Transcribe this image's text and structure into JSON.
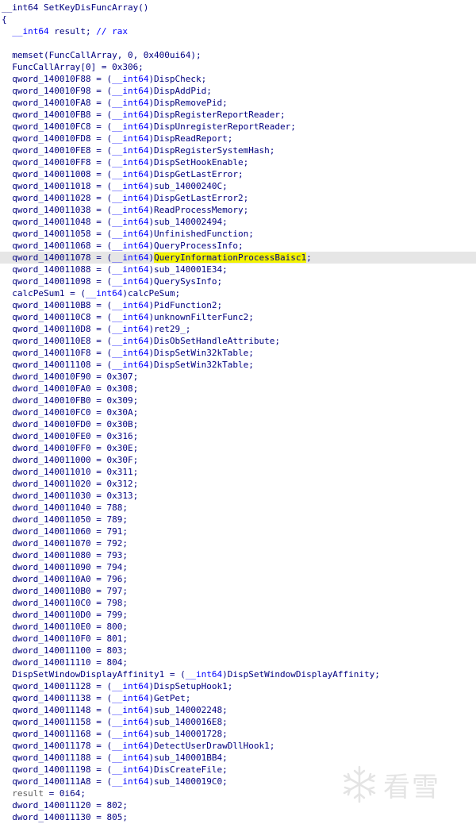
{
  "watermark": {
    "text": "看雪",
    "icon": "snowflake-icon"
  },
  "lines": [
    {
      "segs": [
        {
          "t": "__int64 SetKeyDisFuncArray()",
          "c": ""
        }
      ]
    },
    {
      "segs": [
        {
          "t": "{",
          "c": ""
        }
      ]
    },
    {
      "segs": [
        {
          "t": "  ",
          "c": ""
        },
        {
          "t": "__int64",
          "c": "ty"
        },
        {
          "t": " result; ",
          "c": ""
        },
        {
          "t": "// rax",
          "c": "cm"
        }
      ]
    },
    {
      "segs": [
        {
          "t": "",
          "c": ""
        }
      ]
    },
    {
      "segs": [
        {
          "t": "  memset(FuncCallArray, 0, 0x400ui64);",
          "c": ""
        }
      ]
    },
    {
      "segs": [
        {
          "t": "  FuncCallArray[0] = 0x306;",
          "c": ""
        }
      ]
    },
    {
      "segs": [
        {
          "t": "  qword_140010F88 = (",
          "c": ""
        },
        {
          "t": "__int64",
          "c": "ty"
        },
        {
          "t": ")DispCheck;",
          "c": ""
        }
      ]
    },
    {
      "segs": [
        {
          "t": "  qword_140010F98 = (",
          "c": ""
        },
        {
          "t": "__int64",
          "c": "ty"
        },
        {
          "t": ")DispAddPid;",
          "c": ""
        }
      ]
    },
    {
      "segs": [
        {
          "t": "  qword_140010FA8 = (",
          "c": ""
        },
        {
          "t": "__int64",
          "c": "ty"
        },
        {
          "t": ")DispRemovePid;",
          "c": ""
        }
      ]
    },
    {
      "segs": [
        {
          "t": "  qword_140010FB8 = (",
          "c": ""
        },
        {
          "t": "__int64",
          "c": "ty"
        },
        {
          "t": ")DispRegisterReportReader;",
          "c": ""
        }
      ]
    },
    {
      "segs": [
        {
          "t": "  qword_140010FC8 = (",
          "c": ""
        },
        {
          "t": "__int64",
          "c": "ty"
        },
        {
          "t": ")DispUnregisterReportReader;",
          "c": ""
        }
      ]
    },
    {
      "segs": [
        {
          "t": "  qword_140010FD8 = (",
          "c": ""
        },
        {
          "t": "__int64",
          "c": "ty"
        },
        {
          "t": ")DispReadReport;",
          "c": ""
        }
      ]
    },
    {
      "segs": [
        {
          "t": "  qword_140010FE8 = (",
          "c": ""
        },
        {
          "t": "__int64",
          "c": "ty"
        },
        {
          "t": ")DispRegisterSystemHash;",
          "c": ""
        }
      ]
    },
    {
      "segs": [
        {
          "t": "  qword_140010FF8 = (",
          "c": ""
        },
        {
          "t": "__int64",
          "c": "ty"
        },
        {
          "t": ")DispSetHookEnable;",
          "c": ""
        }
      ]
    },
    {
      "segs": [
        {
          "t": "  qword_140011008 = (",
          "c": ""
        },
        {
          "t": "__int64",
          "c": "ty"
        },
        {
          "t": ")DispGetLastError;",
          "c": ""
        }
      ]
    },
    {
      "segs": [
        {
          "t": "  qword_140011018 = (",
          "c": ""
        },
        {
          "t": "__int64",
          "c": "ty"
        },
        {
          "t": ")sub_14000240C;",
          "c": ""
        }
      ]
    },
    {
      "segs": [
        {
          "t": "  qword_140011028 = (",
          "c": ""
        },
        {
          "t": "__int64",
          "c": "ty"
        },
        {
          "t": ")DispGetLastError2;",
          "c": ""
        }
      ]
    },
    {
      "segs": [
        {
          "t": "  qword_140011038 = (",
          "c": ""
        },
        {
          "t": "__int64",
          "c": "ty"
        },
        {
          "t": ")ReadProcessMemory;",
          "c": ""
        }
      ]
    },
    {
      "segs": [
        {
          "t": "  qword_140011048 = (",
          "c": ""
        },
        {
          "t": "__int64",
          "c": "ty"
        },
        {
          "t": ")sub_140002494;",
          "c": ""
        }
      ]
    },
    {
      "segs": [
        {
          "t": "  qword_140011058 = (",
          "c": ""
        },
        {
          "t": "__int64",
          "c": "ty"
        },
        {
          "t": ")UnfinishedFunction;",
          "c": ""
        }
      ]
    },
    {
      "segs": [
        {
          "t": "  qword_140011068 = (",
          "c": ""
        },
        {
          "t": "__int64",
          "c": "ty"
        },
        {
          "t": ")QueryProcessInfo;",
          "c": ""
        }
      ]
    },
    {
      "hl": true,
      "segs": [
        {
          "t": "  qword_140011078 = (",
          "c": ""
        },
        {
          "t": "__int64",
          "c": "ty"
        },
        {
          "t": ")",
          "c": ""
        },
        {
          "t": "QueryInformationProcessBaisc1",
          "c": "hi"
        },
        {
          "t": ";",
          "c": ""
        }
      ]
    },
    {
      "segs": [
        {
          "t": "  qword_140011088 = (",
          "c": ""
        },
        {
          "t": "__int64",
          "c": "ty"
        },
        {
          "t": ")sub_140001E34;",
          "c": ""
        }
      ]
    },
    {
      "segs": [
        {
          "t": "  qword_140011098 = (",
          "c": ""
        },
        {
          "t": "__int64",
          "c": "ty"
        },
        {
          "t": ")QuerySysInfo;",
          "c": ""
        }
      ]
    },
    {
      "segs": [
        {
          "t": "  calcPeSum1 = (",
          "c": ""
        },
        {
          "t": "__int64",
          "c": "ty"
        },
        {
          "t": ")calcPeSum;",
          "c": ""
        }
      ]
    },
    {
      "segs": [
        {
          "t": "  qword_1400110B8 = (",
          "c": ""
        },
        {
          "t": "__int64",
          "c": "ty"
        },
        {
          "t": ")PidFunction2;",
          "c": ""
        }
      ]
    },
    {
      "segs": [
        {
          "t": "  qword_1400110C8 = (",
          "c": ""
        },
        {
          "t": "__int64",
          "c": "ty"
        },
        {
          "t": ")unknownFilterFunc2;",
          "c": ""
        }
      ]
    },
    {
      "segs": [
        {
          "t": "  qword_1400110D8 = (",
          "c": ""
        },
        {
          "t": "__int64",
          "c": "ty"
        },
        {
          "t": ")ret29_;",
          "c": ""
        }
      ]
    },
    {
      "segs": [
        {
          "t": "  qword_1400110E8 = (",
          "c": ""
        },
        {
          "t": "__int64",
          "c": "ty"
        },
        {
          "t": ")DisObSetHandleAttribute;",
          "c": ""
        }
      ]
    },
    {
      "segs": [
        {
          "t": "  qword_1400110F8 = (",
          "c": ""
        },
        {
          "t": "__int64",
          "c": "ty"
        },
        {
          "t": ")DispSetWin32kTable;",
          "c": ""
        }
      ]
    },
    {
      "segs": [
        {
          "t": "  qword_140011108 = (",
          "c": ""
        },
        {
          "t": "__int64",
          "c": "ty"
        },
        {
          "t": ")DispSetWin32kTable;",
          "c": ""
        }
      ]
    },
    {
      "segs": [
        {
          "t": "  dword_140010F90 = 0x307;",
          "c": ""
        }
      ]
    },
    {
      "segs": [
        {
          "t": "  dword_140010FA0 = 0x308;",
          "c": ""
        }
      ]
    },
    {
      "segs": [
        {
          "t": "  dword_140010FB0 = 0x309;",
          "c": ""
        }
      ]
    },
    {
      "segs": [
        {
          "t": "  dword_140010FC0 = 0x30A;",
          "c": ""
        }
      ]
    },
    {
      "segs": [
        {
          "t": "  dword_140010FD0 = 0x30B;",
          "c": ""
        }
      ]
    },
    {
      "segs": [
        {
          "t": "  dword_140010FE0 = 0x316;",
          "c": ""
        }
      ]
    },
    {
      "segs": [
        {
          "t": "  dword_140010FF0 = 0x30E;",
          "c": ""
        }
      ]
    },
    {
      "segs": [
        {
          "t": "  dword_140011000 = 0x30F;",
          "c": ""
        }
      ]
    },
    {
      "segs": [
        {
          "t": "  dword_140011010 = 0x311;",
          "c": ""
        }
      ]
    },
    {
      "segs": [
        {
          "t": "  dword_140011020 = 0x312;",
          "c": ""
        }
      ]
    },
    {
      "segs": [
        {
          "t": "  dword_140011030 = 0x313;",
          "c": ""
        }
      ]
    },
    {
      "segs": [
        {
          "t": "  dword_140011040 = 788;",
          "c": ""
        }
      ]
    },
    {
      "segs": [
        {
          "t": "  dword_140011050 = 789;",
          "c": ""
        }
      ]
    },
    {
      "segs": [
        {
          "t": "  dword_140011060 = 791;",
          "c": ""
        }
      ]
    },
    {
      "segs": [
        {
          "t": "  dword_140011070 = 792;",
          "c": ""
        }
      ]
    },
    {
      "segs": [
        {
          "t": "  dword_140011080 = 793;",
          "c": ""
        }
      ]
    },
    {
      "segs": [
        {
          "t": "  dword_140011090 = 794;",
          "c": ""
        }
      ]
    },
    {
      "segs": [
        {
          "t": "  dword_1400110A0 = 796;",
          "c": ""
        }
      ]
    },
    {
      "segs": [
        {
          "t": "  dword_1400110B0 = 797;",
          "c": ""
        }
      ]
    },
    {
      "segs": [
        {
          "t": "  dword_1400110C0 = 798;",
          "c": ""
        }
      ]
    },
    {
      "segs": [
        {
          "t": "  dword_1400110D0 = 799;",
          "c": ""
        }
      ]
    },
    {
      "segs": [
        {
          "t": "  dword_1400110E0 = 800;",
          "c": ""
        }
      ]
    },
    {
      "segs": [
        {
          "t": "  dword_1400110F0 = 801;",
          "c": ""
        }
      ]
    },
    {
      "segs": [
        {
          "t": "  dword_140011100 = 803;",
          "c": ""
        }
      ]
    },
    {
      "segs": [
        {
          "t": "  dword_140011110 = 804;",
          "c": ""
        }
      ]
    },
    {
      "segs": [
        {
          "t": "  DispSetWindowDisplayAffinity1 = (",
          "c": ""
        },
        {
          "t": "__int64",
          "c": "ty"
        },
        {
          "t": ")DispSetWindowDisplayAffinity;",
          "c": ""
        }
      ]
    },
    {
      "segs": [
        {
          "t": "  qword_140011128 = (",
          "c": ""
        },
        {
          "t": "__int64",
          "c": "ty"
        },
        {
          "t": ")DispSetupHook1;",
          "c": ""
        }
      ]
    },
    {
      "segs": [
        {
          "t": "  qword_140011138 = (",
          "c": ""
        },
        {
          "t": "__int64",
          "c": "ty"
        },
        {
          "t": ")GetPet;",
          "c": ""
        }
      ]
    },
    {
      "segs": [
        {
          "t": "  qword_140011148 = (",
          "c": ""
        },
        {
          "t": "__int64",
          "c": "ty"
        },
        {
          "t": ")sub_140002248;",
          "c": ""
        }
      ]
    },
    {
      "segs": [
        {
          "t": "  qword_140011158 = (",
          "c": ""
        },
        {
          "t": "__int64",
          "c": "ty"
        },
        {
          "t": ")sub_1400016E8;",
          "c": ""
        }
      ]
    },
    {
      "segs": [
        {
          "t": "  qword_140011168 = (",
          "c": ""
        },
        {
          "t": "__int64",
          "c": "ty"
        },
        {
          "t": ")sub_140001728;",
          "c": ""
        }
      ]
    },
    {
      "segs": [
        {
          "t": "  qword_140011178 = (",
          "c": ""
        },
        {
          "t": "__int64",
          "c": "ty"
        },
        {
          "t": ")DetectUserDrawDllHook1;",
          "c": ""
        }
      ]
    },
    {
      "segs": [
        {
          "t": "  qword_140011188 = (",
          "c": ""
        },
        {
          "t": "__int64",
          "c": "ty"
        },
        {
          "t": ")sub_140001BB4;",
          "c": ""
        }
      ]
    },
    {
      "segs": [
        {
          "t": "  qword_140011198 = (",
          "c": ""
        },
        {
          "t": "__int64",
          "c": "ty"
        },
        {
          "t": ")DisCreateFile;",
          "c": ""
        }
      ]
    },
    {
      "segs": [
        {
          "t": "  qword_1400111A8 = (",
          "c": ""
        },
        {
          "t": "__int64",
          "c": "ty"
        },
        {
          "t": ")sub_1400019C0;",
          "c": ""
        }
      ]
    },
    {
      "segs": [
        {
          "t": "  ",
          "c": ""
        },
        {
          "t": "result",
          "c": "gry"
        },
        {
          "t": " = 0i64;",
          "c": ""
        }
      ]
    },
    {
      "segs": [
        {
          "t": "  dword_140011120 = 802;",
          "c": ""
        }
      ]
    },
    {
      "segs": [
        {
          "t": "  dword_140011130 = 805;",
          "c": ""
        }
      ]
    }
  ]
}
